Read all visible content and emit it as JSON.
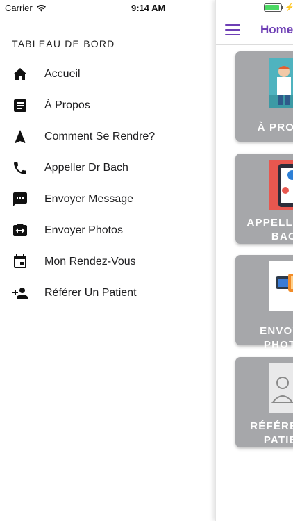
{
  "status_bar": {
    "carrier": "Carrier",
    "time": "9:14 AM",
    "battery_level": 0.9,
    "wifi_icon": "wifi-icon",
    "charging_icon": "bolt-icon"
  },
  "drawer": {
    "title": "TABLEAU DE BORD",
    "items": [
      {
        "label": "Accueil",
        "icon": "home-icon"
      },
      {
        "label": "À Propos",
        "icon": "article-icon"
      },
      {
        "label": "Comment Se Rendre?",
        "icon": "navigation-icon"
      },
      {
        "label": "Appeller Dr Bach",
        "icon": "phone-icon"
      },
      {
        "label": "Envoyer Message",
        "icon": "message-icon"
      },
      {
        "label": "Envoyer Photos",
        "icon": "camera-switch-icon"
      },
      {
        "label": "Mon Rendez-Vous",
        "icon": "calendar-icon"
      },
      {
        "label": "Référer Un Patient",
        "icon": "person-add-icon"
      }
    ]
  },
  "main": {
    "header": {
      "title": "Home",
      "menu_icon": "hamburger-icon"
    },
    "cards": [
      {
        "label_line1": "À PROPOS",
        "label_line2": ""
      },
      {
        "label_line1": "APPELLER DR",
        "label_line2": "BACH"
      },
      {
        "label_line1": "ENVOYER PHOTOS",
        "label_line2": ""
      },
      {
        "label_line1": "RÉFÉRER UN",
        "label_line2": "PATIENT"
      }
    ]
  },
  "colors": {
    "accent": "#6e3fb5",
    "card_bg": "#a6a7aa",
    "card_text": "#ffffff",
    "drawer_bg": "#ffffff"
  }
}
